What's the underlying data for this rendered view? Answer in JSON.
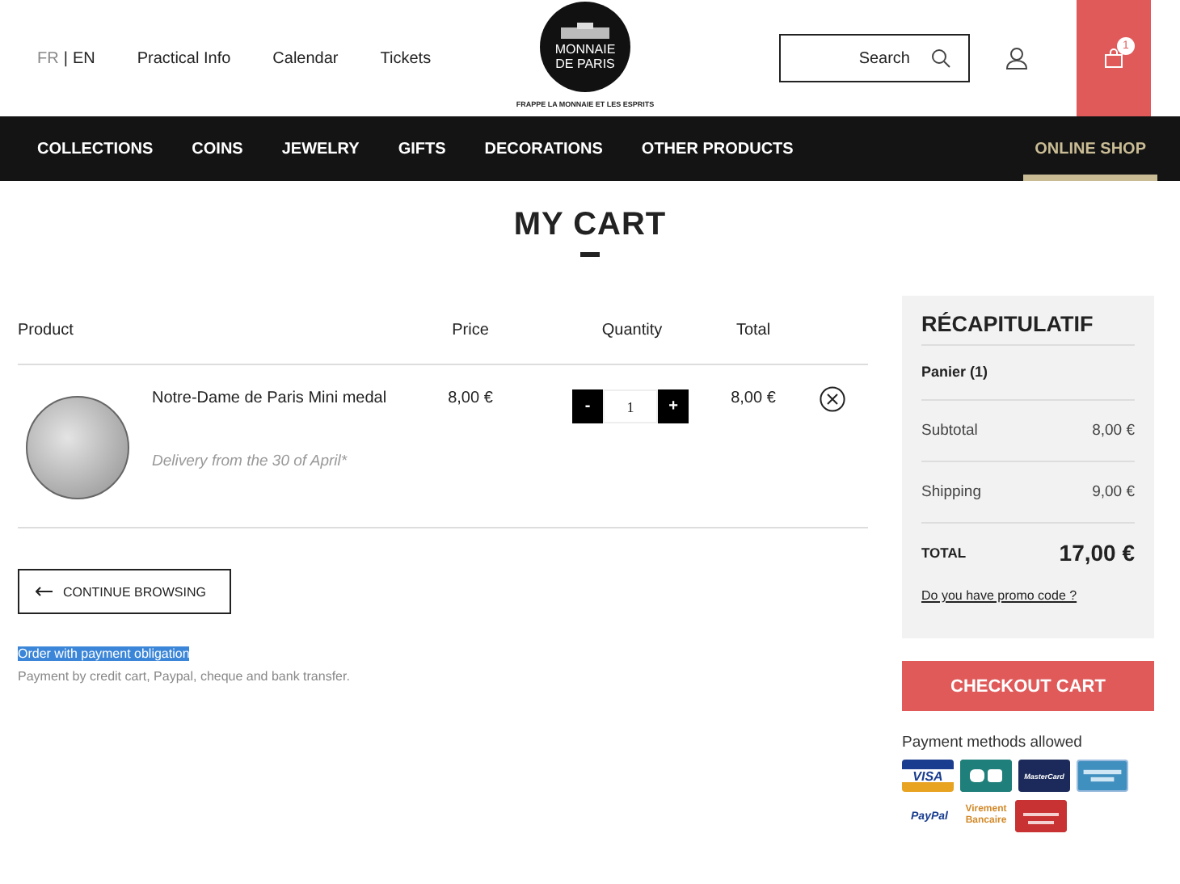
{
  "header": {
    "languages": [
      {
        "label": "FR",
        "selected": false
      },
      {
        "label": "EN",
        "selected": true
      }
    ],
    "language_separator": "|",
    "links": [
      "Practical Info",
      "Calendar",
      "Tickets"
    ],
    "logo": {
      "line1": "MONNAIE",
      "line2": "DE PARIS",
      "tagline": "FRAPPE LA MONNAIE ET LES ESPRITS"
    },
    "search": {
      "placeholder": "Search"
    },
    "cart_count": "1"
  },
  "nav": [
    {
      "label": "COLLECTIONS",
      "selected": false
    },
    {
      "label": "COINS",
      "selected": false
    },
    {
      "label": "JEWELRY",
      "selected": false
    },
    {
      "label": "GIFTS",
      "selected": false
    },
    {
      "label": "DECORATIONS",
      "selected": false
    },
    {
      "label": "OTHER PRODUCTS",
      "selected": false
    },
    {
      "label": "ONLINE SHOP",
      "selected": true
    }
  ],
  "title": "MY CART",
  "table": {
    "columns": [
      "Product",
      "Price",
      "Quantity",
      "Total"
    ],
    "rows": [
      {
        "name": "Notre-Dame de Paris Mini medal",
        "delivery": "Delivery from the 30 of April*",
        "price": "8,00 €",
        "minus": "-",
        "quantity": "1",
        "plus": "+",
        "total": "8,00 €"
      }
    ]
  },
  "continue_button": "CONTINUE BROWSING",
  "notice": {
    "title": "Order with payment obligation",
    "text": "Payment by credit cart, Paypal, cheque and bank transfer."
  },
  "summary": {
    "title": "RÉCAPITULATIF",
    "cart": "Panier (1)",
    "lines": [
      {
        "label": "Subtotal",
        "value": "8,00 €"
      },
      {
        "label": "Shipping",
        "value": "9,00 €"
      }
    ],
    "total_label": "TOTAL",
    "total_value": "17,00 €",
    "promo": "Do you have promo code ?"
  },
  "checkout_button": "CHECKOUT CART",
  "payment": {
    "title": "Payment methods allowed",
    "logos": [
      {
        "kind": "visa",
        "label": "VISA"
      },
      {
        "kind": "cb"
      },
      {
        "kind": "mastercard",
        "label": "MasterCard"
      },
      {
        "kind": "amex"
      },
      {
        "kind": "paypal",
        "label": "PayPal"
      },
      {
        "kind": "transfer",
        "label": "Virement Bancaire"
      },
      {
        "kind": "cheque"
      }
    ]
  }
}
